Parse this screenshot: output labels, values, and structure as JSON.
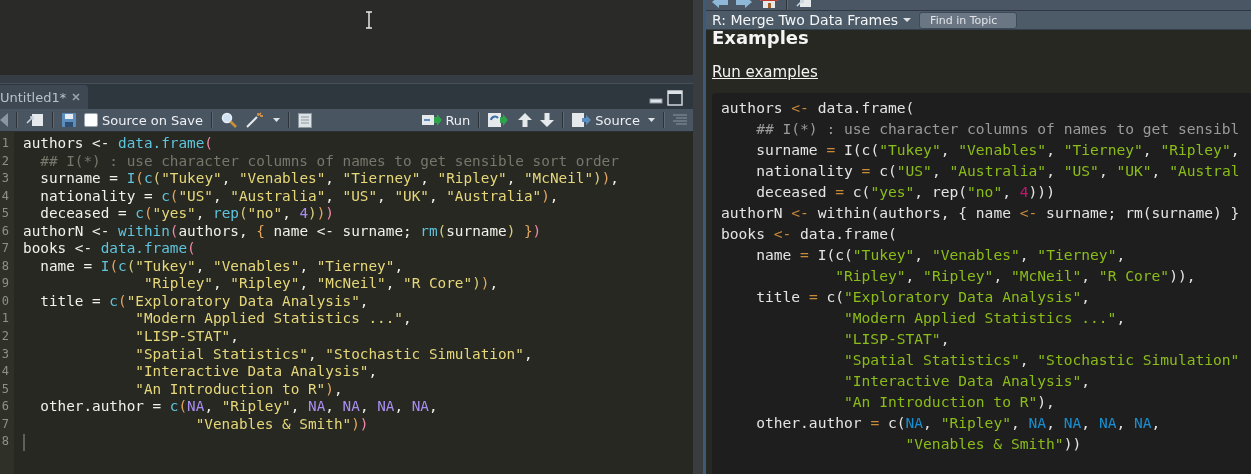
{
  "editor": {
    "tab": {
      "label": "Untitled1*",
      "selected": true
    },
    "toolbar": {
      "source_on_save": {
        "label": "Source on Save",
        "checked": false
      },
      "run": "Run",
      "source": "Source"
    },
    "gutter": [
      "1",
      "2",
      "3",
      "4",
      "5",
      "6",
      "7",
      "8",
      "9",
      "0",
      "1",
      "2",
      "3",
      "4",
      "5",
      "6",
      "7",
      "8"
    ],
    "lines": [
      [
        {
          "text": "authors <- ",
          "kind": "id"
        },
        {
          "text": "data.frame",
          "kind": "fn"
        },
        {
          "text": "(",
          "kind": "p1"
        }
      ],
      [
        {
          "text": "  ## I(*) : use character columns of names to get sensible sort order",
          "kind": "cm"
        }
      ],
      [
        {
          "text": "  surname = ",
          "kind": "id"
        },
        {
          "text": "I",
          "kind": "fn"
        },
        {
          "text": "(",
          "kind": "p2"
        },
        {
          "text": "c",
          "kind": "fn"
        },
        {
          "text": "(",
          "kind": "p3"
        },
        {
          "text": "\"Tukey\"",
          "kind": "str"
        },
        {
          "text": ", ",
          "kind": "id"
        },
        {
          "text": "\"Venables\"",
          "kind": "str"
        },
        {
          "text": ", ",
          "kind": "id"
        },
        {
          "text": "\"Tierney\"",
          "kind": "str"
        },
        {
          "text": ", ",
          "kind": "id"
        },
        {
          "text": "\"Ripley\"",
          "kind": "str"
        },
        {
          "text": ", ",
          "kind": "id"
        },
        {
          "text": "\"McNeil\"",
          "kind": "str"
        },
        {
          "text": ")",
          "kind": "p3"
        },
        {
          "text": ")",
          "kind": "p2"
        },
        {
          "text": ",",
          "kind": "id"
        }
      ],
      [
        {
          "text": "  nationality = ",
          "kind": "id"
        },
        {
          "text": "c",
          "kind": "fn"
        },
        {
          "text": "(",
          "kind": "p2"
        },
        {
          "text": "\"US\"",
          "kind": "str"
        },
        {
          "text": ", ",
          "kind": "id"
        },
        {
          "text": "\"Australia\"",
          "kind": "str"
        },
        {
          "text": ", ",
          "kind": "id"
        },
        {
          "text": "\"US\"",
          "kind": "str"
        },
        {
          "text": ", ",
          "kind": "id"
        },
        {
          "text": "\"UK\"",
          "kind": "str"
        },
        {
          "text": ", ",
          "kind": "id"
        },
        {
          "text": "\"Australia\"",
          "kind": "str"
        },
        {
          "text": ")",
          "kind": "p2"
        },
        {
          "text": ",",
          "kind": "id"
        }
      ],
      [
        {
          "text": "  deceased = ",
          "kind": "id"
        },
        {
          "text": "c",
          "kind": "fn"
        },
        {
          "text": "(",
          "kind": "p2"
        },
        {
          "text": "\"yes\"",
          "kind": "str"
        },
        {
          "text": ", ",
          "kind": "id"
        },
        {
          "text": "rep",
          "kind": "fn"
        },
        {
          "text": "(",
          "kind": "p3"
        },
        {
          "text": "\"no\"",
          "kind": "str"
        },
        {
          "text": ", ",
          "kind": "id"
        },
        {
          "text": "4",
          "kind": "num"
        },
        {
          "text": ")",
          "kind": "p3"
        },
        {
          "text": ")",
          "kind": "p2"
        },
        {
          "text": ")",
          "kind": "p1"
        }
      ],
      [
        {
          "text": "authorN <- ",
          "kind": "id"
        },
        {
          "text": "within",
          "kind": "fn"
        },
        {
          "text": "(",
          "kind": "p1"
        },
        {
          "text": "authors, ",
          "kind": "id"
        },
        {
          "text": "{",
          "kind": "p2"
        },
        {
          "text": " name <- surname; ",
          "kind": "id"
        },
        {
          "text": "rm",
          "kind": "fn"
        },
        {
          "text": "(",
          "kind": "p3"
        },
        {
          "text": "surname",
          "kind": "id"
        },
        {
          "text": ")",
          "kind": "p3"
        },
        {
          "text": " }",
          "kind": "p2"
        },
        {
          "text": ")",
          "kind": "p1"
        }
      ],
      [
        {
          "text": "books <- ",
          "kind": "id"
        },
        {
          "text": "data.frame",
          "kind": "fn"
        },
        {
          "text": "(",
          "kind": "p1"
        }
      ],
      [
        {
          "text": "  name = ",
          "kind": "id"
        },
        {
          "text": "I",
          "kind": "fn"
        },
        {
          "text": "(",
          "kind": "p2"
        },
        {
          "text": "c",
          "kind": "fn"
        },
        {
          "text": "(",
          "kind": "p3"
        },
        {
          "text": "\"Tukey\"",
          "kind": "str"
        },
        {
          "text": ", ",
          "kind": "id"
        },
        {
          "text": "\"Venables\"",
          "kind": "str"
        },
        {
          "text": ", ",
          "kind": "id"
        },
        {
          "text": "\"Tierney\"",
          "kind": "str"
        },
        {
          "text": ",",
          "kind": "id"
        }
      ],
      [
        {
          "text": "              \"Ripley\"",
          "kind": "str"
        },
        {
          "text": ", ",
          "kind": "id"
        },
        {
          "text": "\"Ripley\"",
          "kind": "str"
        },
        {
          "text": ", ",
          "kind": "id"
        },
        {
          "text": "\"McNeil\"",
          "kind": "str"
        },
        {
          "text": ", ",
          "kind": "id"
        },
        {
          "text": "\"R Core\"",
          "kind": "str"
        },
        {
          "text": ")",
          "kind": "p3"
        },
        {
          "text": ")",
          "kind": "p2"
        },
        {
          "text": ",",
          "kind": "id"
        }
      ],
      [
        {
          "text": "  title = ",
          "kind": "id"
        },
        {
          "text": "c",
          "kind": "fn"
        },
        {
          "text": "(",
          "kind": "p2"
        },
        {
          "text": "\"Exploratory Data Analysis\"",
          "kind": "str"
        },
        {
          "text": ",",
          "kind": "id"
        }
      ],
      [
        {
          "text": "             \"Modern Applied Statistics ...\"",
          "kind": "str"
        },
        {
          "text": ",",
          "kind": "id"
        }
      ],
      [
        {
          "text": "             \"LISP-STAT\"",
          "kind": "str"
        },
        {
          "text": ",",
          "kind": "id"
        }
      ],
      [
        {
          "text": "             \"Spatial Statistics\"",
          "kind": "str"
        },
        {
          "text": ", ",
          "kind": "id"
        },
        {
          "text": "\"Stochastic Simulation\"",
          "kind": "str"
        },
        {
          "text": ",",
          "kind": "id"
        }
      ],
      [
        {
          "text": "             \"Interactive Data Analysis\"",
          "kind": "str"
        },
        {
          "text": ",",
          "kind": "id"
        }
      ],
      [
        {
          "text": "             \"An Introduction to R\"",
          "kind": "str"
        },
        {
          "text": ")",
          "kind": "p2"
        },
        {
          "text": ",",
          "kind": "id"
        }
      ],
      [
        {
          "text": "  other.author = ",
          "kind": "id"
        },
        {
          "text": "c",
          "kind": "fn"
        },
        {
          "text": "(",
          "kind": "p2"
        },
        {
          "text": "NA",
          "kind": "num"
        },
        {
          "text": ", ",
          "kind": "id"
        },
        {
          "text": "\"Ripley\"",
          "kind": "str"
        },
        {
          "text": ", ",
          "kind": "id"
        },
        {
          "text": "NA",
          "kind": "num"
        },
        {
          "text": ", ",
          "kind": "id"
        },
        {
          "text": "NA",
          "kind": "num"
        },
        {
          "text": ", ",
          "kind": "id"
        },
        {
          "text": "NA",
          "kind": "num"
        },
        {
          "text": ", ",
          "kind": "id"
        },
        {
          "text": "NA",
          "kind": "num"
        },
        {
          "text": ",",
          "kind": "id"
        }
      ],
      [
        {
          "text": "                    \"Venables & Smith\"",
          "kind": "str"
        },
        {
          "text": ")",
          "kind": "p2"
        },
        {
          "text": ")",
          "kind": "p1"
        }
      ]
    ]
  },
  "help": {
    "title": "R: Merge Two Data Frames",
    "find": {
      "placeholder": "Find in Topic"
    },
    "heading": "Examples",
    "link": "Run examples",
    "lines": [
      [
        {
          "text": "authors ",
          "kind": "id"
        },
        {
          "text": "<-",
          "kind": "op"
        },
        {
          "text": " data.frame(",
          "kind": "id"
        }
      ],
      [
        {
          "text": "    ## I(*) : use character columns of names to get sensibl",
          "kind": "cm"
        }
      ],
      [
        {
          "text": "    surname ",
          "kind": "id"
        },
        {
          "text": "=",
          "kind": "op"
        },
        {
          "text": " I(c(",
          "kind": "id"
        },
        {
          "text": "\"Tukey\"",
          "kind": "str"
        },
        {
          "text": ", ",
          "kind": "id"
        },
        {
          "text": "\"Venables\"",
          "kind": "str"
        },
        {
          "text": ", ",
          "kind": "id"
        },
        {
          "text": "\"Tierney\"",
          "kind": "str"
        },
        {
          "text": ", ",
          "kind": "id"
        },
        {
          "text": "\"Ripley\"",
          "kind": "str"
        },
        {
          "text": ",",
          "kind": "id"
        }
      ],
      [
        {
          "text": "    nationality ",
          "kind": "id"
        },
        {
          "text": "=",
          "kind": "op"
        },
        {
          "text": " c(",
          "kind": "id"
        },
        {
          "text": "\"US\"",
          "kind": "str"
        },
        {
          "text": ", ",
          "kind": "id"
        },
        {
          "text": "\"Australia\"",
          "kind": "str"
        },
        {
          "text": ", ",
          "kind": "id"
        },
        {
          "text": "\"US\"",
          "kind": "str"
        },
        {
          "text": ", ",
          "kind": "id"
        },
        {
          "text": "\"UK\"",
          "kind": "str"
        },
        {
          "text": ", ",
          "kind": "id"
        },
        {
          "text": "\"Austral",
          "kind": "str"
        }
      ],
      [
        {
          "text": "    deceased ",
          "kind": "id"
        },
        {
          "text": "=",
          "kind": "op"
        },
        {
          "text": " c(",
          "kind": "id"
        },
        {
          "text": "\"yes\"",
          "kind": "str"
        },
        {
          "text": ", rep(",
          "kind": "id"
        },
        {
          "text": "\"no\"",
          "kind": "str"
        },
        {
          "text": ", ",
          "kind": "id"
        },
        {
          "text": "4",
          "kind": "num"
        },
        {
          "text": ")))",
          "kind": "id"
        }
      ],
      [
        {
          "text": "authorN ",
          "kind": "id"
        },
        {
          "text": "<-",
          "kind": "op"
        },
        {
          "text": " within(authors, { name ",
          "kind": "id"
        },
        {
          "text": "<-",
          "kind": "op"
        },
        {
          "text": " surname; rm(surname) }",
          "kind": "id"
        }
      ],
      [
        {
          "text": "books ",
          "kind": "id"
        },
        {
          "text": "<-",
          "kind": "op"
        },
        {
          "text": " data.frame(",
          "kind": "id"
        }
      ],
      [
        {
          "text": "    name ",
          "kind": "id"
        },
        {
          "text": "=",
          "kind": "op"
        },
        {
          "text": " I(c(",
          "kind": "id"
        },
        {
          "text": "\"Tukey\"",
          "kind": "str"
        },
        {
          "text": ", ",
          "kind": "id"
        },
        {
          "text": "\"Venables\"",
          "kind": "str"
        },
        {
          "text": ", ",
          "kind": "id"
        },
        {
          "text": "\"Tierney\"",
          "kind": "str"
        },
        {
          "text": ",",
          "kind": "id"
        }
      ],
      [
        {
          "text": "             \"Ripley\"",
          "kind": "str"
        },
        {
          "text": ", ",
          "kind": "id"
        },
        {
          "text": "\"Ripley\"",
          "kind": "str"
        },
        {
          "text": ", ",
          "kind": "id"
        },
        {
          "text": "\"McNeil\"",
          "kind": "str"
        },
        {
          "text": ", ",
          "kind": "id"
        },
        {
          "text": "\"R Core\"",
          "kind": "str"
        },
        {
          "text": ")),",
          "kind": "id"
        }
      ],
      [
        {
          "text": "    title ",
          "kind": "id"
        },
        {
          "text": "=",
          "kind": "op"
        },
        {
          "text": " c(",
          "kind": "id"
        },
        {
          "text": "\"Exploratory Data Analysis\"",
          "kind": "str"
        },
        {
          "text": ",",
          "kind": "id"
        }
      ],
      [
        {
          "text": "              \"Modern Applied Statistics ...\"",
          "kind": "str"
        },
        {
          "text": ",",
          "kind": "id"
        }
      ],
      [
        {
          "text": "              \"LISP-STAT\"",
          "kind": "str"
        },
        {
          "text": ",",
          "kind": "id"
        }
      ],
      [
        {
          "text": "              \"Spatial Statistics\"",
          "kind": "str"
        },
        {
          "text": ", ",
          "kind": "id"
        },
        {
          "text": "\"Stochastic Simulation\"",
          "kind": "str"
        }
      ],
      [
        {
          "text": "              \"Interactive Data Analysis\"",
          "kind": "str"
        },
        {
          "text": ",",
          "kind": "id"
        }
      ],
      [
        {
          "text": "              \"An Introduction to R\"",
          "kind": "str"
        },
        {
          "text": "),",
          "kind": "id"
        }
      ],
      [
        {
          "text": "    other.author ",
          "kind": "id"
        },
        {
          "text": "=",
          "kind": "op"
        },
        {
          "text": " c(",
          "kind": "id"
        },
        {
          "text": "NA",
          "kind": "na"
        },
        {
          "text": ", ",
          "kind": "id"
        },
        {
          "text": "\"Ripley\"",
          "kind": "str"
        },
        {
          "text": ", ",
          "kind": "id"
        },
        {
          "text": "NA",
          "kind": "na"
        },
        {
          "text": ", ",
          "kind": "id"
        },
        {
          "text": "NA",
          "kind": "na"
        },
        {
          "text": ", ",
          "kind": "id"
        },
        {
          "text": "NA",
          "kind": "na"
        },
        {
          "text": ", ",
          "kind": "id"
        },
        {
          "text": "NA",
          "kind": "na"
        },
        {
          "text": ",",
          "kind": "id"
        }
      ],
      [
        {
          "text": "                     \"Venables & Smith\"",
          "kind": "str"
        },
        {
          "text": "))",
          "kind": "id"
        }
      ]
    ]
  }
}
